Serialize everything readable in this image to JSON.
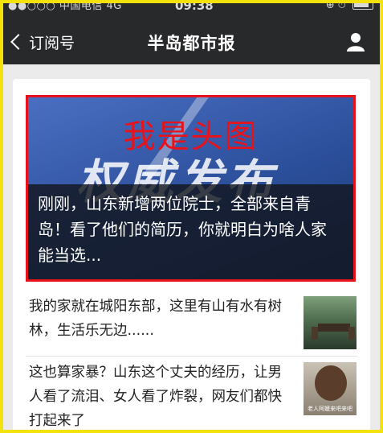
{
  "status_bar": {
    "carrier": "●●○○○ 中国电信  4G",
    "time": "09:38",
    "right_icons": "⊕ ⏱"
  },
  "nav": {
    "back_label": "订阅号",
    "title": "半岛都市报"
  },
  "hero": {
    "overlay_tag": "我是头图",
    "bg_word": "权威发布",
    "caption": "刚刚，山东新增两位院士，全部来自青岛！看了他们的简历，你就明白为啥人家能当选..."
  },
  "articles": [
    {
      "title": "我的家就在城阳东部，这里有山有水有树林，生活乐无边......",
      "thumb_text": ""
    },
    {
      "title": "这也算家暴？山东这个丈夫的经历，让男人看了流泪、女人看了炸裂，网友们都快打起来了",
      "thumb_text": "老人阿嬤来吧来吧"
    }
  ],
  "colors": {
    "frame": "#f4e20c",
    "highlight_border": "#e8131a",
    "navbar": "#28292b"
  }
}
